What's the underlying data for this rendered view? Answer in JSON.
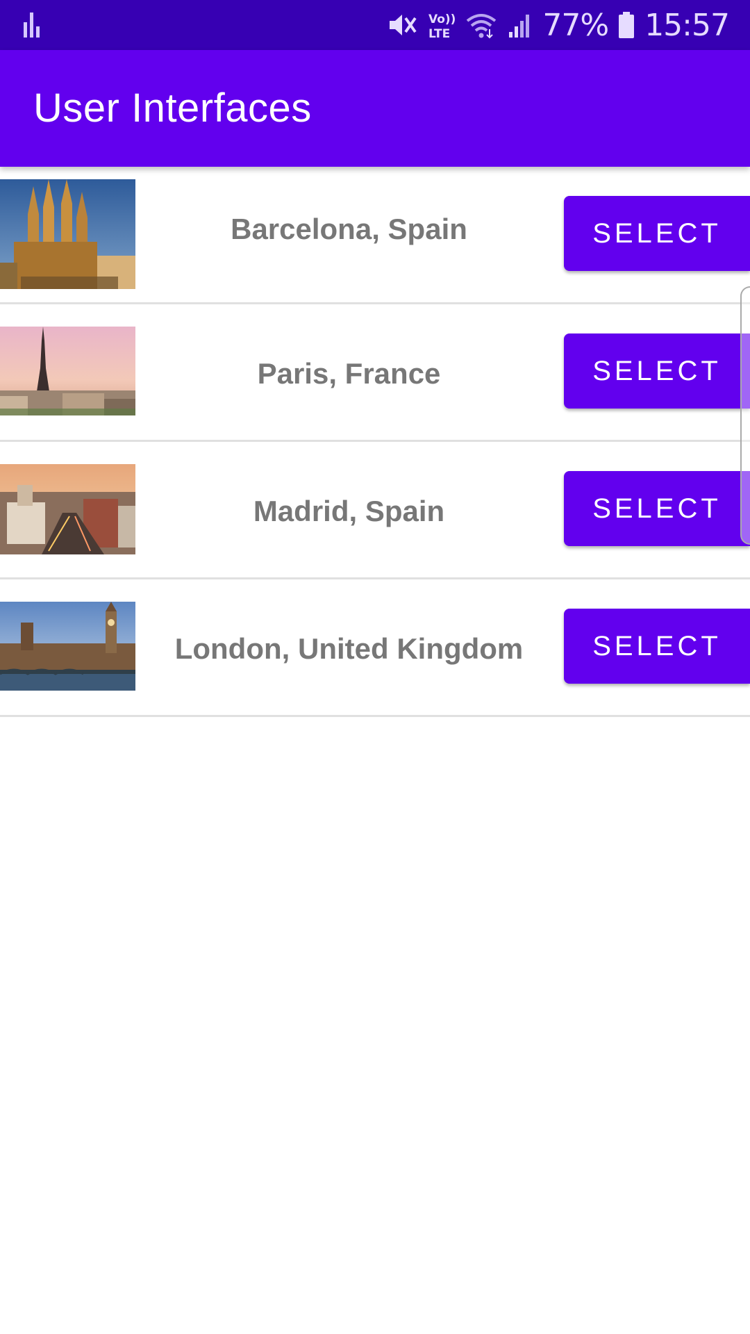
{
  "status_bar": {
    "battery": "77%",
    "time": "15:57",
    "icons": [
      "activity-bars-icon",
      "mute-icon",
      "volte-icon",
      "wifi-icon",
      "signal-icon",
      "battery-icon"
    ],
    "volte_text": "Vo))",
    "lte_text": "LTE"
  },
  "app_bar": {
    "title": "User Interfaces",
    "color": "#6200ee"
  },
  "colors": {
    "accent": "#6200ee",
    "status_bar": "#3700b3",
    "label": "#777777"
  },
  "list": {
    "items": [
      {
        "city": "Barcelona, Spain",
        "button": "SELECT",
        "image": "sagrada-familia-photo"
      },
      {
        "city": "Paris, France",
        "button": "SELECT",
        "image": "eiffel-tower-photo"
      },
      {
        "city": "Madrid, Spain",
        "button": "SELECT",
        "image": "madrid-skyline-photo"
      },
      {
        "city": "London, United Kingdom",
        "button": "SELECT",
        "image": "big-ben-photo"
      }
    ]
  }
}
